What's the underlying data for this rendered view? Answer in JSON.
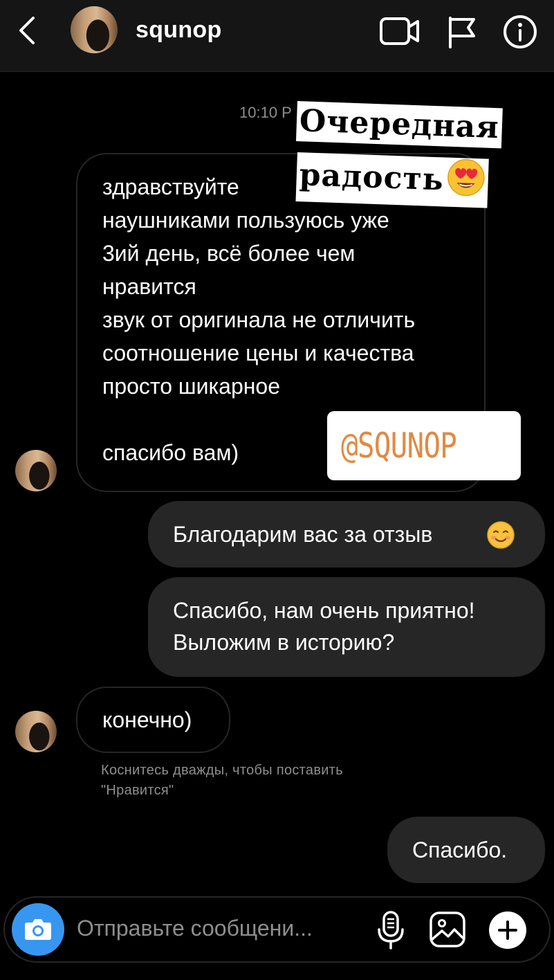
{
  "header": {
    "username": "squnop",
    "icons": [
      "back-chevron-icon",
      "video-call-icon",
      "flag-icon",
      "info-icon"
    ]
  },
  "conversation": {
    "timestamp": "10:10 P",
    "message1": {
      "lines": [
        "здравствуйте",
        "наушниками пользуюсь уже",
        "3ий день, всё более чем",
        "нравится",
        "звук от оригинала не отличить",
        "соотношение цены и качества",
        "просто шикарное",
        "спасибо вам)"
      ]
    },
    "message2": {
      "text": "Благодарим вас за отзыв",
      "emoji": "smiling-face-icon"
    },
    "message3": {
      "lines": [
        "Спасибо, нам очень приятно!",
        "Выложим в историю?"
      ]
    },
    "message4": {
      "text": "конечно)"
    },
    "hint": {
      "lines": [
        "Коснитесь дважды, чтобы поставить",
        "\"Нравится\""
      ]
    },
    "message5": {
      "text": "Спасибо."
    }
  },
  "stickers": {
    "caption_line1": "Очередная",
    "caption_line2": "радость",
    "caption_emoji": "heart-eyes-emoji-icon",
    "mention": "@SQUNOP"
  },
  "composer": {
    "placeholder": "Отправьте сообщени...",
    "icons": [
      "camera-icon",
      "microphone-icon",
      "gallery-icon",
      "plus-icon"
    ]
  },
  "colors": {
    "background": "#000000",
    "header_bg": "#151515",
    "outgoing_bubble": "#262626",
    "incoming_border": "#262626",
    "camera_button": "#3797f0",
    "muted_text": "#8e8e8e",
    "mention_text": "#e08a43"
  }
}
